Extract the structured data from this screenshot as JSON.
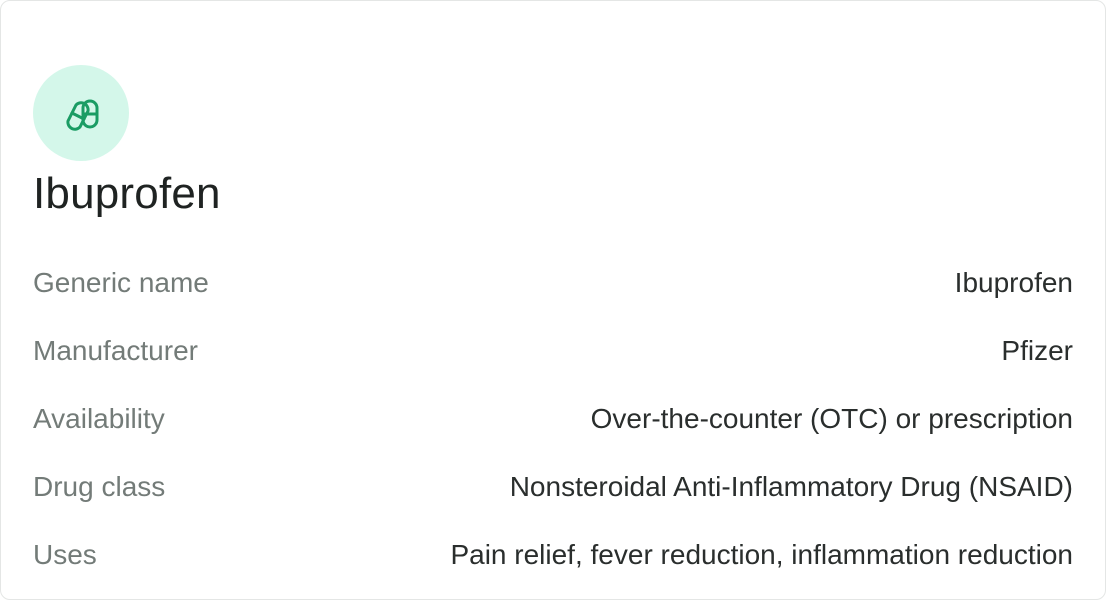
{
  "drug": {
    "title": "Ibuprofen",
    "icon": "pill-capsule-icon",
    "accent_color": "#1a9c64",
    "badge_color": "#d4f7ea"
  },
  "details": [
    {
      "label": "Generic name",
      "value": "Ibuprofen"
    },
    {
      "label": "Manufacturer",
      "value": "Pfizer"
    },
    {
      "label": "Availability",
      "value": "Over-the-counter (OTC) or prescription"
    },
    {
      "label": "Drug class",
      "value": "Nonsteroidal Anti-Inflammatory Drug (NSAID)"
    },
    {
      "label": "Uses",
      "value": "Pain relief, fever reduction, inflammation reduction"
    }
  ]
}
